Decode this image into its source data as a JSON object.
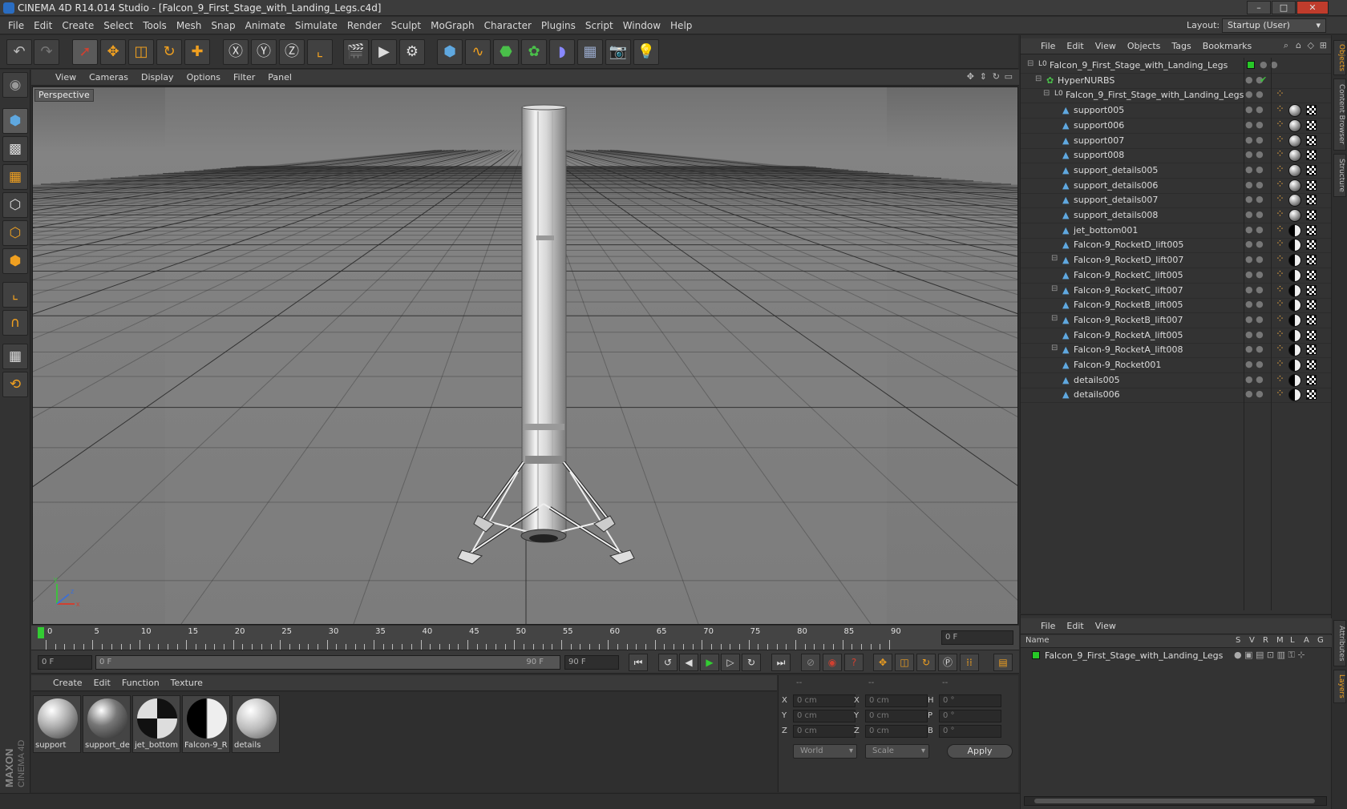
{
  "window": {
    "title": "CINEMA 4D R14.014 Studio - [Falcon_9_First_Stage_with_Landing_Legs.c4d]",
    "minimize": "–",
    "maximize": "□",
    "close": "✕"
  },
  "menubar": {
    "items": [
      "File",
      "Edit",
      "Create",
      "Select",
      "Tools",
      "Mesh",
      "Snap",
      "Animate",
      "Simulate",
      "Render",
      "Sculpt",
      "MoGraph",
      "Character",
      "Plugins",
      "Script",
      "Window",
      "Help"
    ],
    "layout_label": "Layout:",
    "layout_value": "Startup (User)"
  },
  "viewport": {
    "menu": [
      "View",
      "Cameras",
      "Display",
      "Options",
      "Filter",
      "Panel"
    ],
    "label": "Perspective",
    "axis_x": "x",
    "axis_y": "y",
    "axis_z": "z"
  },
  "timeline": {
    "ticks": [
      "0",
      "5",
      "10",
      "15",
      "20",
      "25",
      "30",
      "35",
      "40",
      "45",
      "50",
      "55",
      "60",
      "65",
      "70",
      "75",
      "80",
      "85",
      "90"
    ],
    "current_frame": "0 F"
  },
  "playbar": {
    "start": "0 F",
    "range_start": "0 F",
    "range_end": "90 F",
    "end": "90 F"
  },
  "material_manager": {
    "menu": [
      "Create",
      "Edit",
      "Function",
      "Texture"
    ],
    "materials": [
      {
        "name": "support"
      },
      {
        "name": "support_de"
      },
      {
        "name": "jet_bottom"
      },
      {
        "name": "Falcon-9_R"
      },
      {
        "name": "details"
      }
    ]
  },
  "coordinates": {
    "header": [
      "--",
      "--",
      "--"
    ],
    "rows": [
      {
        "a": "X",
        "av": "0 cm",
        "b": "X",
        "bv": "0 cm",
        "c": "H",
        "cv": "0 °"
      },
      {
        "a": "Y",
        "av": "0 cm",
        "b": "Y",
        "bv": "0 cm",
        "c": "P",
        "cv": "0 °"
      },
      {
        "a": "Z",
        "av": "0 cm",
        "b": "Z",
        "bv": "0 cm",
        "c": "B",
        "cv": "0 °"
      }
    ],
    "mode": "World",
    "transform": "Scale",
    "apply": "Apply"
  },
  "object_manager": {
    "menu": [
      "File",
      "Edit",
      "View",
      "Objects",
      "Tags",
      "Bookmarks"
    ],
    "objects": [
      {
        "name": "Falcon_9_First_Stage_with_Landing_Legs",
        "icon": "null-icon",
        "level": 0
      },
      {
        "name": "HyperNURBS",
        "icon": "hypernurbs-icon",
        "level": 1
      },
      {
        "name": "Falcon_9_First_Stage_with_Landing_Legs",
        "icon": "null-icon",
        "level": 2
      },
      {
        "name": "support005",
        "icon": "polygon-icon",
        "level": 3
      },
      {
        "name": "support006",
        "icon": "polygon-icon",
        "level": 3
      },
      {
        "name": "support007",
        "icon": "polygon-icon",
        "level": 3
      },
      {
        "name": "support008",
        "icon": "polygon-icon",
        "level": 3
      },
      {
        "name": "support_details005",
        "icon": "polygon-icon",
        "level": 3
      },
      {
        "name": "support_details006",
        "icon": "polygon-icon",
        "level": 3
      },
      {
        "name": "support_details007",
        "icon": "polygon-icon",
        "level": 3
      },
      {
        "name": "support_details008",
        "icon": "polygon-icon",
        "level": 3
      },
      {
        "name": "jet_bottom001",
        "icon": "polygon-icon",
        "level": 3
      },
      {
        "name": "Falcon-9_RocketD_lift005",
        "icon": "polygon-icon",
        "level": 3
      },
      {
        "name": "Falcon-9_RocketD_lift007",
        "icon": "polygon-icon",
        "level": 3
      },
      {
        "name": "Falcon-9_RocketC_lift005",
        "icon": "polygon-icon",
        "level": 3
      },
      {
        "name": "Falcon-9_RocketC_lift007",
        "icon": "polygon-icon",
        "level": 3
      },
      {
        "name": "Falcon-9_RocketB_lift005",
        "icon": "polygon-icon",
        "level": 3
      },
      {
        "name": "Falcon-9_RocketB_lift007",
        "icon": "polygon-icon",
        "level": 3
      },
      {
        "name": "Falcon-9_RocketA_lift005",
        "icon": "polygon-icon",
        "level": 3
      },
      {
        "name": "Falcon-9_RocketA_lift008",
        "icon": "polygon-icon",
        "level": 3
      },
      {
        "name": "Falcon-9_Rocket001",
        "icon": "polygon-icon",
        "level": 3
      },
      {
        "name": "details005",
        "icon": "polygon-icon",
        "level": 3
      },
      {
        "name": "details006",
        "icon": "polygon-icon",
        "level": 3
      }
    ]
  },
  "side_tabs": [
    "Objects",
    "Content Browser",
    "Structure",
    "Attributes",
    "Layers"
  ],
  "layer_manager": {
    "menu": [
      "File",
      "Edit",
      "View"
    ],
    "columns": {
      "name": "Name",
      "flags": [
        "S",
        "V",
        "R",
        "M",
        "L",
        "A",
        "G"
      ]
    },
    "layers": [
      {
        "name": "Falcon_9_First_Stage_with_Landing_Legs"
      }
    ]
  },
  "brand": {
    "logo_text": "MAXON CINEMA 4D"
  },
  "colors": {
    "accent": "#f0a020",
    "layer_green": "#27c827",
    "selection_blue": "#5fa8e0"
  }
}
